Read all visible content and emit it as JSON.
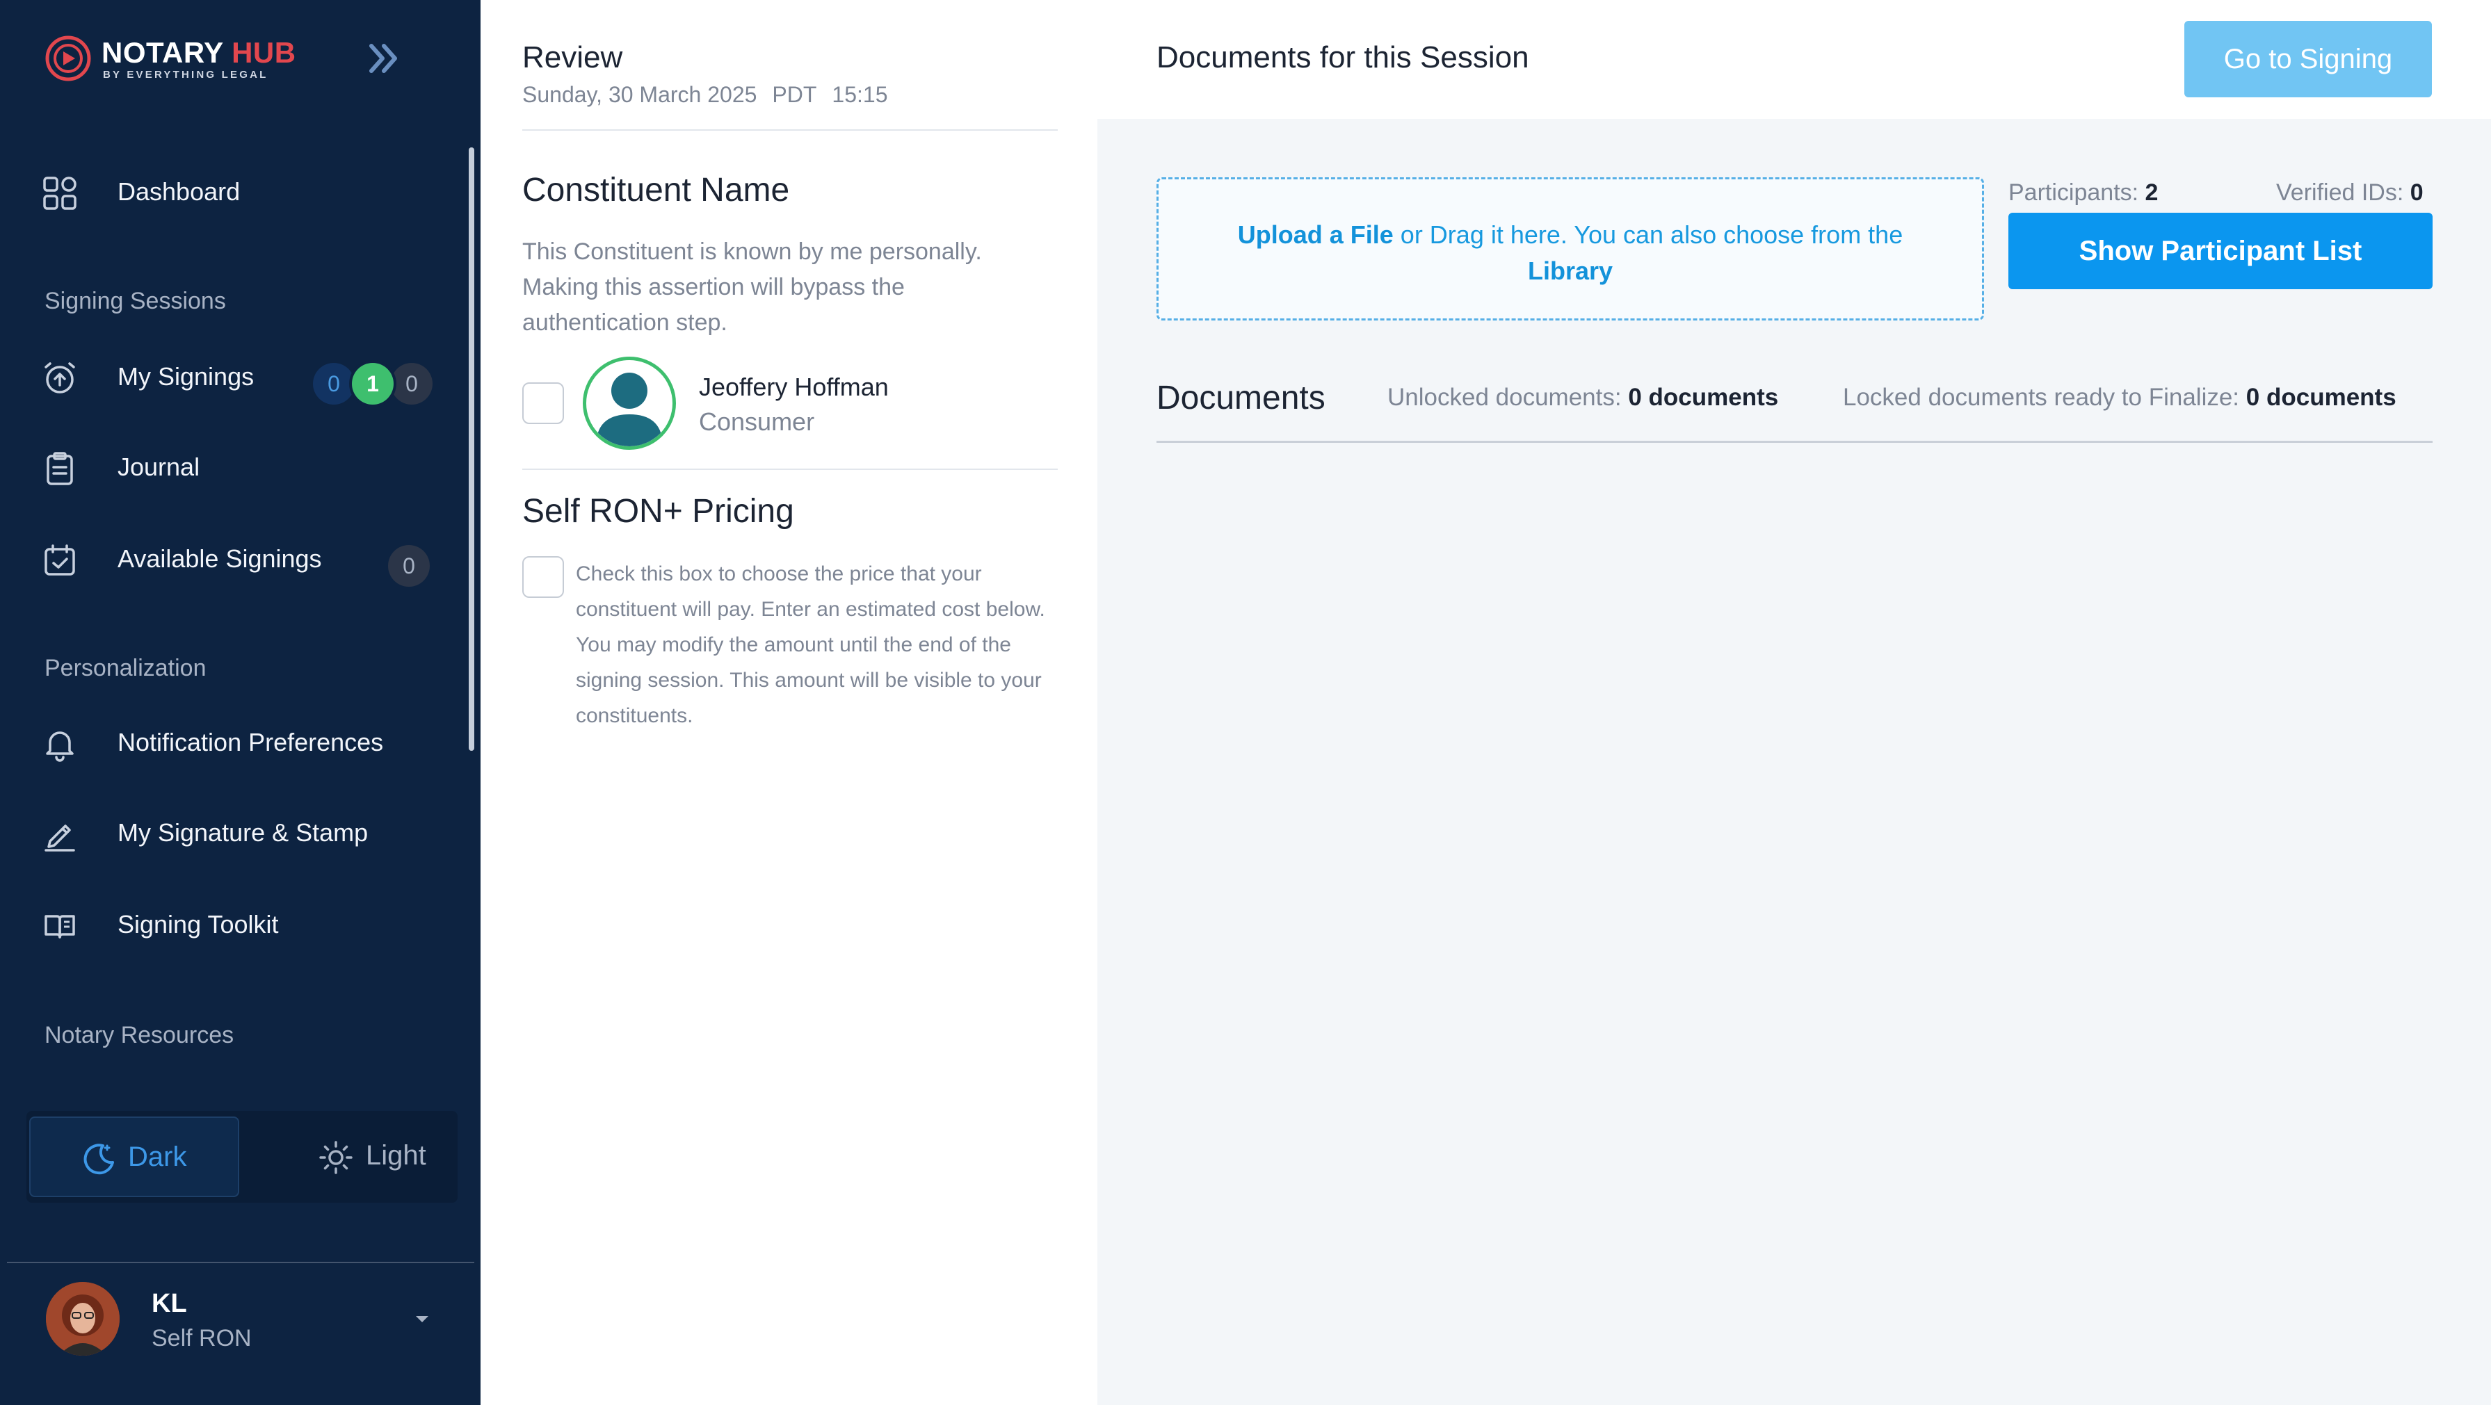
{
  "brand": {
    "name_part1": "NOTARY",
    "name_part2": "HUB",
    "tagline": "BY EVERYTHING LEGAL",
    "accent_color": "#e2474e"
  },
  "sidebar": {
    "collapse_icon": "double-chevron-right-icon",
    "dashboard": {
      "label": "Dashboard",
      "icon": "dashboard-grid-icon"
    },
    "section_signing": "Signing Sessions",
    "my_signings": {
      "label": "My Signings",
      "icon": "alarm-upload-icon",
      "counts": [
        "0",
        "1",
        "0"
      ]
    },
    "journal": {
      "label": "Journal",
      "icon": "clipboard-icon"
    },
    "available_signings": {
      "label": "Available Signings",
      "icon": "calendar-check-icon",
      "count": "0"
    },
    "section_personalization": "Personalization",
    "notification_prefs": {
      "label": "Notification Preferences",
      "icon": "bell-icon"
    },
    "signature_stamp": {
      "label": "My Signature & Stamp",
      "icon": "pen-icon"
    },
    "signing_toolkit": {
      "label": "Signing Toolkit",
      "icon": "book-icon"
    },
    "section_resources": "Notary Resources",
    "theme": {
      "dark_label": "Dark",
      "light_label": "Light",
      "selected": "Dark"
    },
    "user": {
      "initials": "KL",
      "role": "Self RON"
    }
  },
  "review": {
    "title": "Review",
    "date": "Sunday, 30 March 2025",
    "timezone": "PDT",
    "time": "15:15",
    "constituent_heading": "Constituent Name",
    "constituent_text": "This Constituent is known by me personally. Making this assertion will bypass the authentication step.",
    "person_name": "Jeoffery Hoffman",
    "person_role": "Consumer",
    "pricing_heading": "Self RON+ Pricing",
    "pricing_text": "Check this box to choose the price that your constituent will pay. Enter an estimated cost below. You may modify the amount until the end of the signing session. This amount will be visible to your constituents."
  },
  "documents": {
    "title": "Documents for this Session",
    "go_to_signing": "Go to Signing",
    "upload_link": "Upload a File",
    "upload_middle": " or Drag it here. You can also choose from the ",
    "library_link": "Library",
    "participants_label": "Participants:",
    "participants_count": "2",
    "verified_label": "Verified IDs:",
    "verified_count": "0",
    "show_participants": "Show Participant List",
    "subtitle": "Documents",
    "unlocked_label": "Unlocked documents:",
    "unlocked_value": "0 documents",
    "locked_label": "Locked documents ready to Finalize:",
    "locked_value": "0 documents"
  },
  "colors": {
    "sidebar_bg": "#0d2341",
    "primary_button": "#0b96ef",
    "disabled_button": "#71c5f3",
    "success_green": "#3ebf6e"
  }
}
